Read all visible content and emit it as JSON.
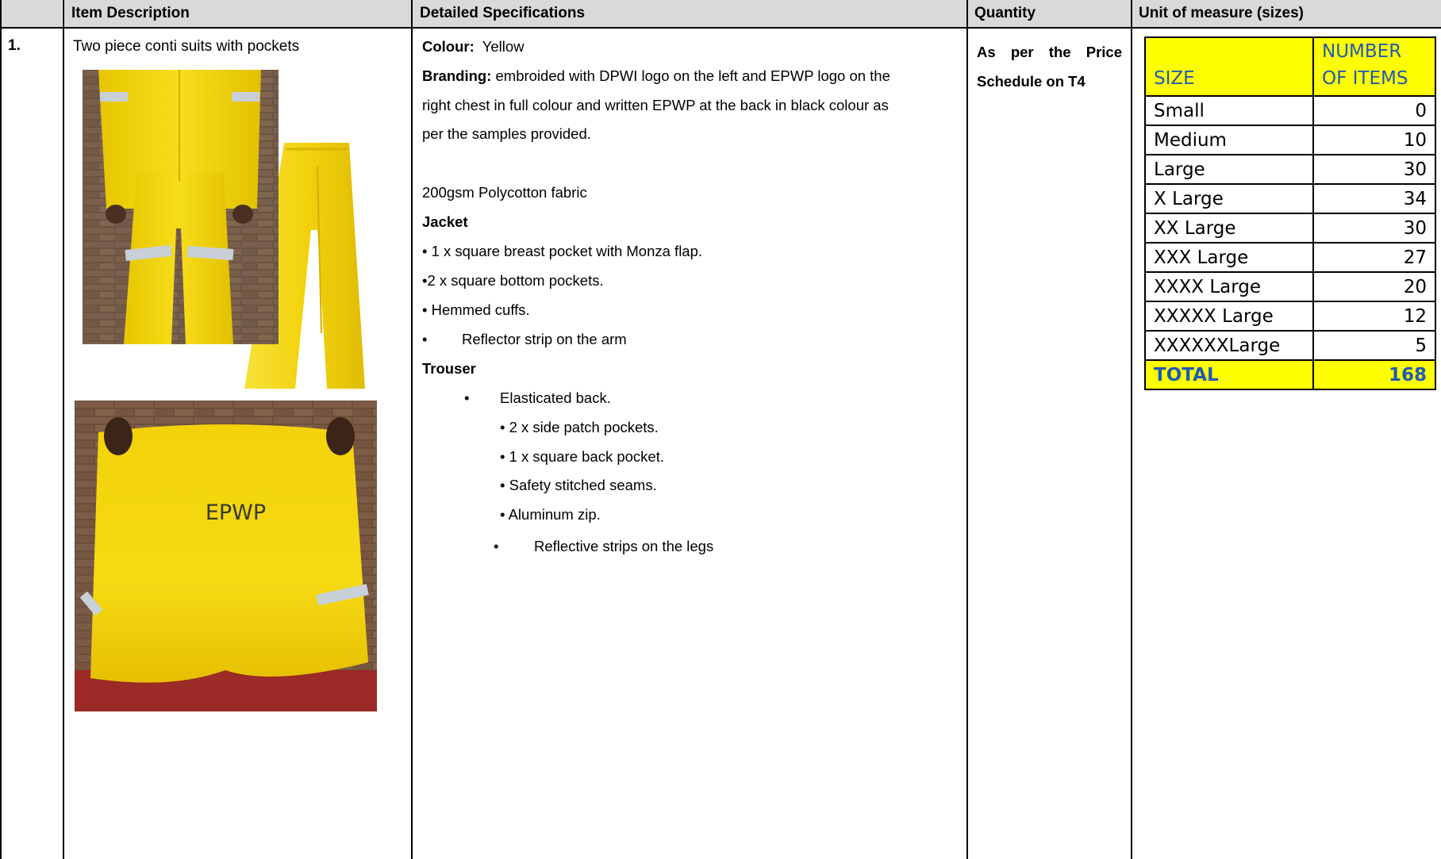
{
  "headers": {
    "num": "",
    "item_description": "Item Description",
    "detailed_specifications": "Detailed Specifications",
    "quantity": "Quantity",
    "unit_of_measure": "Unit of measure (sizes)"
  },
  "row": {
    "number": "1.",
    "item_description": "Two piece conti suits with pockets",
    "photo_text": "EPWP",
    "specs": {
      "colour_label": "Colour:",
      "colour_value": "Yellow",
      "branding_label": "Branding:",
      "branding_line1": "embroided with DPWI logo on the left and EPWP logo on the",
      "branding_line2": "right chest in full colour and written EPWP at the back in black colour as",
      "branding_line3": "per the samples provided.",
      "fabric": "200gsm Polycotton fabric",
      "jacket_heading": "Jacket",
      "jacket_items": [
        "• 1 x square breast pocket with Monza flap.",
        "•2 x square bottom pockets.",
        "• Hemmed cuffs.",
        "Reflector strip on the arm"
      ],
      "trouser_heading": "Trouser",
      "trouser_items": [
        "Elasticated back.",
        "• 2 x side patch pockets.",
        "• 1 x square back pocket.",
        "• Safety stitched seams.",
        "• Aluminum zip.",
        "Reflective strips on the legs"
      ]
    },
    "quantity_line1": "As per the Price",
    "quantity_line2": "Schedule on T4"
  },
  "size_table": {
    "header_size": "SIZE",
    "header_number_line1": "NUMBER",
    "header_number_line2": "OF ITEMS",
    "rows": [
      {
        "size": "Small",
        "count": "0"
      },
      {
        "size": "Medium",
        "count": "10"
      },
      {
        "size": "Large",
        "count": "30"
      },
      {
        "size": "X Large",
        "count": "34"
      },
      {
        "size": "XX Large",
        "count": "30"
      },
      {
        "size": "XXX Large",
        "count": "27"
      },
      {
        "size": "XXXX Large",
        "count": "20"
      },
      {
        "size": "XXXXX Large",
        "count": "12"
      },
      {
        "size": "XXXXXXLarge",
        "count": "5"
      }
    ],
    "total_label": "TOTAL",
    "total_value": "168"
  },
  "colors": {
    "header_bg": "#d9d9d9",
    "highlight_yellow": "#ffff00",
    "header_text_blue": "#1f5ab5",
    "suit_yellow": "#f2d20c"
  }
}
